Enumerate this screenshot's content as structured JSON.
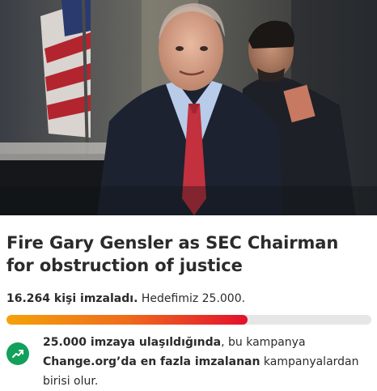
{
  "hero": {
    "image_label": "photo-gary-gensler"
  },
  "petition": {
    "title": "Fire Gary Gensler as SEC Chairman for obstruction of justice"
  },
  "signatures": {
    "count_text": "16.264 kişi imzaladı.",
    "goal_text": "Hedefimiz 25.000.",
    "count": 16264,
    "goal": 25000,
    "progress_fraction": 0.66
  },
  "milestone": {
    "part1_bold": "25.000 imzaya ulaşıldığında",
    "part2": ", bu kampanya",
    "part3_bold": "Change.org’da en fazla imzalanan",
    "part4": " kampanyalardan birisi olur.",
    "icon": "trending-up-icon"
  },
  "colors": {
    "progress_start": "#f4a20a",
    "progress_end": "#e3102d",
    "badge": "#12a05b",
    "track": "#e6e6e6"
  }
}
